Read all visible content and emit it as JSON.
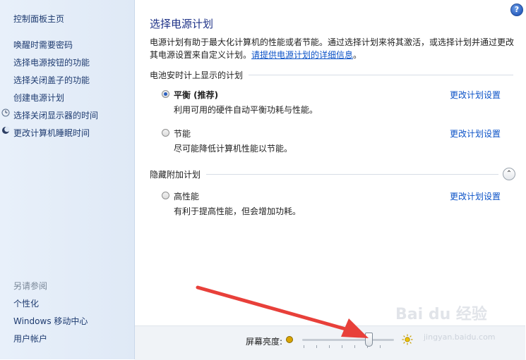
{
  "sidebar": {
    "home": "控制面板主页",
    "links": [
      "唤醒时需要密码",
      "选择电源按钮的功能",
      "选择关闭盖子的功能",
      "创建电源计划",
      "选择关闭显示器的时间",
      "更改计算机睡眠时间"
    ],
    "see_also_header": "另请参阅",
    "see_also": [
      "个性化",
      "Windows 移动中心",
      "用户帐户"
    ]
  },
  "main": {
    "help": "?",
    "title": "选择电源计划",
    "description": "电源计划有助于最大化计算机的性能或者节能。通过选择计划来将其激活，或选择计划并通过更改其电源设置来自定义计划。",
    "more_info_link": "请提供电源计划的详细信息",
    "more_info_suffix": "。",
    "battery_section": "电池安时计上显示的计划",
    "hidden_section": "隐藏附加计划",
    "collapse_symbol": "⌃",
    "plans": [
      {
        "name": "平衡 (推荐)",
        "desc": "利用可用的硬件自动平衡功耗与性能。",
        "selected": true,
        "change": "更改计划设置"
      },
      {
        "name": "节能",
        "desc": "尽可能降低计算机性能以节能。",
        "selected": false,
        "change": "更改计划设置"
      },
      {
        "name": "高性能",
        "desc": "有利于提高性能，但会增加功耗。",
        "selected": false,
        "change": "更改计划设置"
      }
    ]
  },
  "bottom": {
    "brightness_label": "屏幕亮度:",
    "brightness_level": 0.72
  },
  "overlay": {
    "arrow_color": "#e8403a",
    "watermark": "Bai du 经验",
    "watermark_sub": "jingyan.baidu.com"
  }
}
